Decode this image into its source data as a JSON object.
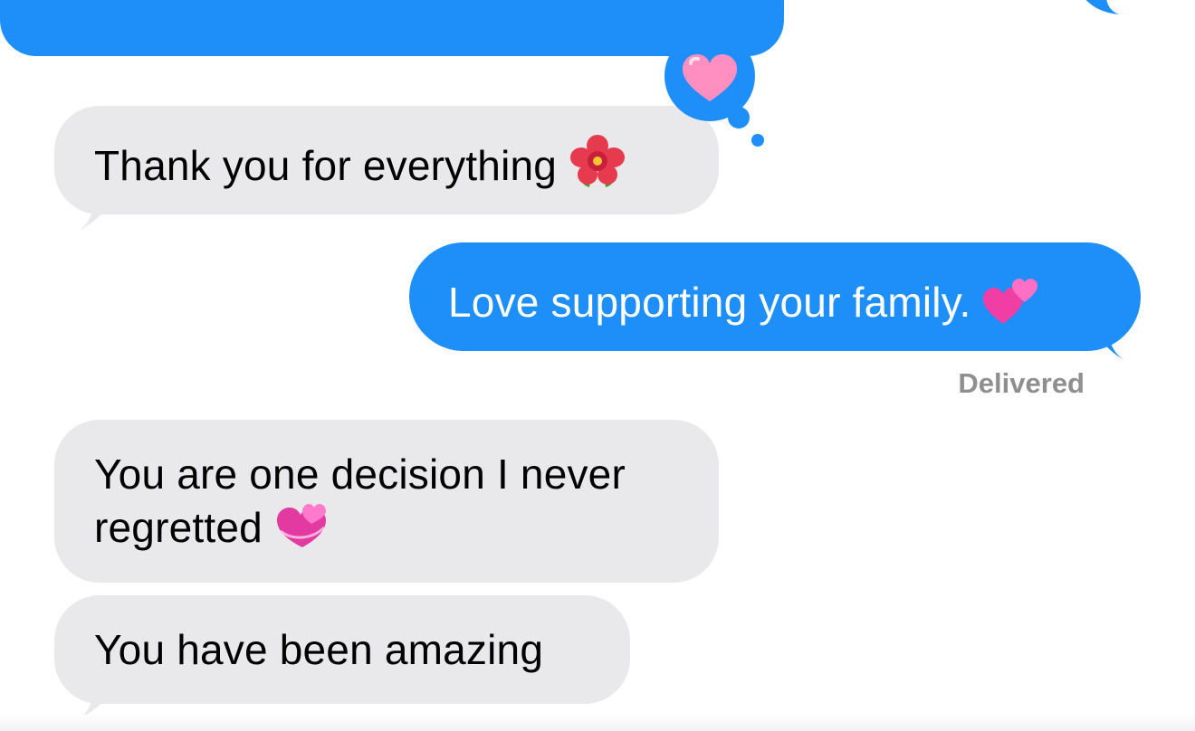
{
  "colors": {
    "sent_bubble": "#1e8ff8",
    "received_bubble": "#e9e9eb",
    "status_text": "#8e8e93"
  },
  "messages": [
    {
      "direction": "received",
      "text": "Thank you for everything",
      "emoji": "hibiscus-icon",
      "tapback": "pink-heart-icon"
    },
    {
      "direction": "sent",
      "text": "Love supporting your family.",
      "emoji": "two-hearts-icon"
    },
    {
      "direction": "received",
      "text": "You are one decision I never regretted",
      "emoji": "revolving-hearts-icon"
    },
    {
      "direction": "received",
      "text": "You have been amazing"
    }
  ],
  "status": {
    "delivered": "Delivered"
  }
}
